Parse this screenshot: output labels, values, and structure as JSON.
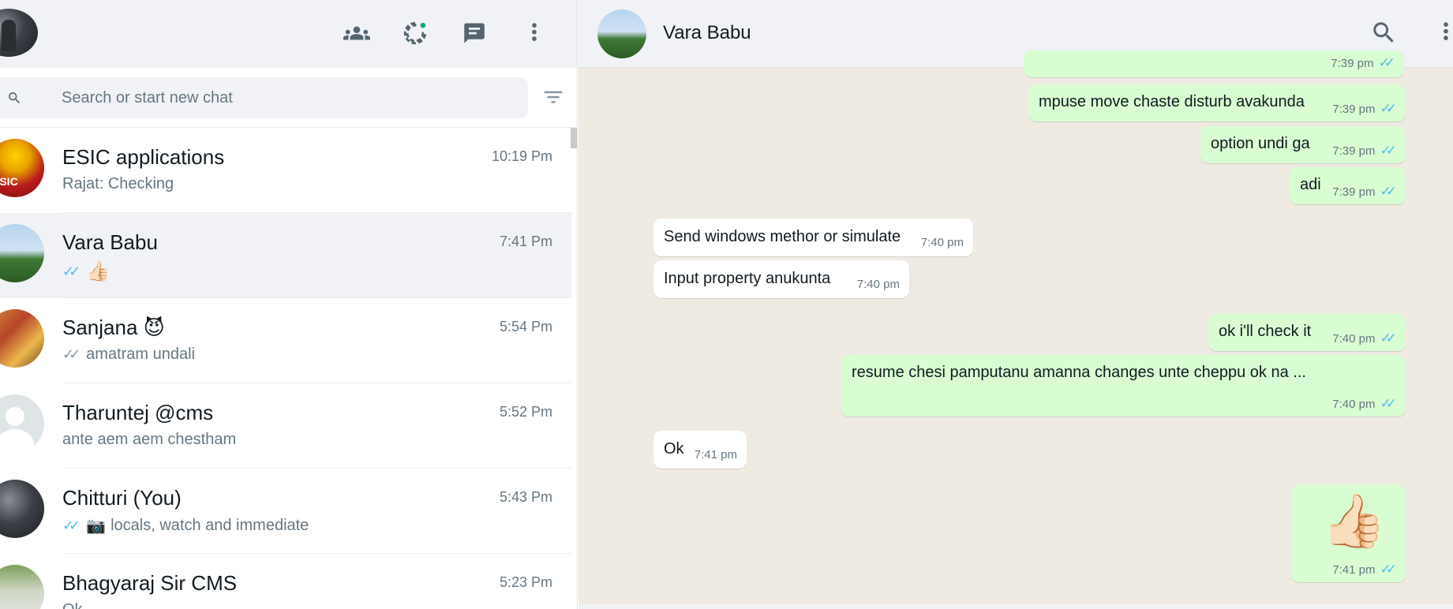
{
  "left_header": {
    "icons": [
      "communities-icon",
      "status-icon",
      "new-chat-icon",
      "menu-icon"
    ]
  },
  "search": {
    "placeholder": "Search or start new chat"
  },
  "chats": [
    {
      "name": "ESIC applications",
      "time": "10:19 Pm",
      "preview": "Rajat: Checking",
      "tick": "",
      "avatar_text": "ESIC"
    },
    {
      "name": "Vara Babu",
      "time": "7:41 Pm",
      "preview": "👍🏻",
      "tick": "✓✓"
    },
    {
      "name": "Sanjana 😈",
      "time": "5:54 Pm",
      "preview": "amatram undali",
      "tick": "✓✓"
    },
    {
      "name": "Tharuntej @cms",
      "time": "5:52 Pm",
      "preview": "ante aem aem chestham",
      "tick": ""
    },
    {
      "name": "Chitturi (You)",
      "time": "5:43 Pm",
      "preview": "locals, watch and immediate",
      "tick": "✓✓",
      "camera": "📷"
    },
    {
      "name": "Bhagyaraj Sir CMS",
      "time": "5:23 Pm",
      "preview": "Ok",
      "tick": ""
    }
  ],
  "conversation": {
    "contact_name": "Vara Babu",
    "messages": [
      {
        "direction": "out",
        "text": "",
        "time": "7:39 pm",
        "tick": "✓✓"
      },
      {
        "direction": "out",
        "text": "mpuse move chaste disturb avakunda",
        "time": "7:39 pm",
        "tick": "✓✓"
      },
      {
        "direction": "out",
        "text": "option undi ga",
        "time": "7:39 pm",
        "tick": "✓✓"
      },
      {
        "direction": "out",
        "text": "adi",
        "time": "7:39 pm",
        "tick": "✓✓"
      },
      {
        "direction": "in",
        "text": "Send windows methor or simulate",
        "time": "7:40 pm"
      },
      {
        "direction": "in",
        "text": "Input property anukunta",
        "time": "7:40 pm"
      },
      {
        "direction": "out",
        "text": "ok i'll check it",
        "time": "7:40 pm",
        "tick": "✓✓"
      },
      {
        "direction": "out",
        "text": "resume chesi pamputanu amanna changes unte cheppu ok na ...",
        "time": "7:40 pm",
        "tick": "✓✓"
      },
      {
        "direction": "in",
        "text": "Ok",
        "time": "7:41 pm"
      },
      {
        "direction": "out",
        "text": "👍🏻",
        "time": "7:41 pm",
        "tick": "✓✓"
      }
    ]
  },
  "colors": {
    "outgoing_bubble": "#d9fdd3",
    "incoming_bubble": "#ffffff",
    "chat_background": "#efeae2",
    "read_tick": "#53bdeb",
    "header_bg": "#f0f2f5"
  }
}
